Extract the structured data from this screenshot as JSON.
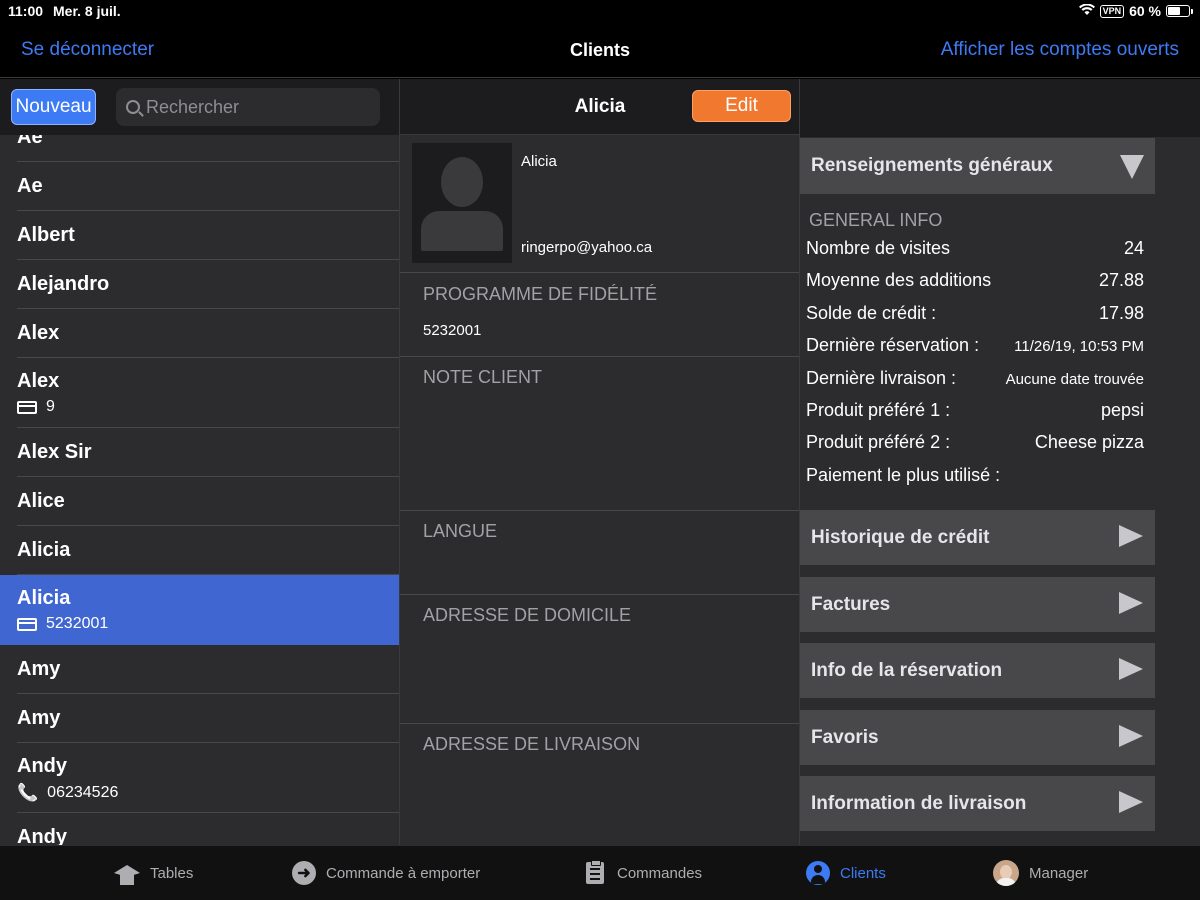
{
  "status": {
    "time": "11:00",
    "date": "Mer. 8 juil.",
    "battery": "60 %",
    "vpn": "VPN",
    "wifi_icon": "wifi-icon"
  },
  "nav": {
    "left": "Se déconnecter",
    "title": "Clients",
    "right": "Afficher les comptes ouverts"
  },
  "list_toolbar": {
    "new_label": "Nouveau",
    "search_placeholder": "Rechercher",
    "search_value": ""
  },
  "clients": [
    {
      "name": "Ae",
      "sub": "",
      "sub_icon": ""
    },
    {
      "name": "Ae",
      "sub": "",
      "sub_icon": ""
    },
    {
      "name": "Albert",
      "sub": "",
      "sub_icon": ""
    },
    {
      "name": "Alejandro",
      "sub": "",
      "sub_icon": ""
    },
    {
      "name": "Alex",
      "sub": "",
      "sub_icon": ""
    },
    {
      "name": "Alex",
      "sub": "9",
      "sub_icon": "card-icon"
    },
    {
      "name": "Alex Sir",
      "sub": "",
      "sub_icon": ""
    },
    {
      "name": "Alice",
      "sub": "",
      "sub_icon": ""
    },
    {
      "name": "Alicia",
      "sub": "",
      "sub_icon": ""
    },
    {
      "name": "Alicia",
      "sub": "5232001",
      "sub_icon": "card-icon",
      "selected": true
    },
    {
      "name": "Amy",
      "sub": "",
      "sub_icon": ""
    },
    {
      "name": "Amy",
      "sub": "",
      "sub_icon": ""
    },
    {
      "name": "Andy",
      "sub": "06234526",
      "sub_icon": "phone-icon"
    },
    {
      "name": "Andy",
      "sub": "",
      "sub_icon": ""
    }
  ],
  "detail": {
    "title": "Alicia",
    "edit_label": "Edit",
    "name": "Alicia",
    "email": "ringerpo@yahoo.ca",
    "fields": [
      {
        "label": "PROGRAMME DE FIDÉLITÉ",
        "value": "5232001"
      },
      {
        "label": "NOTE CLIENT",
        "value": ""
      },
      {
        "label": "LANGUE",
        "value": ""
      },
      {
        "label": "ADRESSE DE DOMICILE",
        "value": ""
      },
      {
        "label": "ADRESSE DE LIVRAISON",
        "value": ""
      }
    ]
  },
  "info": {
    "section_title": "Renseignements généraux",
    "header": "GENERAL INFO",
    "rows": [
      {
        "k": "Nombre de visites",
        "v": "24"
      },
      {
        "k": "Moyenne des additions",
        "v": "27.88"
      },
      {
        "k": "Solde de crédit :",
        "v": "17.98"
      },
      {
        "k": "Dernière réservation :",
        "v": "11/26/19, 10:53 PM"
      },
      {
        "k": "Dernière livraison :",
        "v": "Aucune date trouvée"
      },
      {
        "k": "Produit préféré 1 :",
        "v": "pepsi"
      },
      {
        "k": "Produit préféré 2 :",
        "v": "Cheese pizza"
      },
      {
        "k": "Paiement le plus utilisé :",
        "v": ""
      }
    ],
    "sections": [
      "Historique de crédit",
      "Factures",
      "Info de la réservation",
      "Favoris",
      "Information de livraison"
    ]
  },
  "tabs": [
    {
      "label": "Tables",
      "icon": "graduation-cap-icon"
    },
    {
      "label": "Commande à emporter",
      "icon": "arrow-circle-icon"
    },
    {
      "label": "Commandes",
      "icon": "clipboard-icon"
    },
    {
      "label": "Clients",
      "icon": "user-circle-icon",
      "active": true
    },
    {
      "label": "Manager",
      "icon": "manager-avatar-icon"
    }
  ],
  "colors": {
    "accent": "#3d7bf5",
    "selected_row": "#4066d2",
    "edit_button": "#f0782f"
  }
}
